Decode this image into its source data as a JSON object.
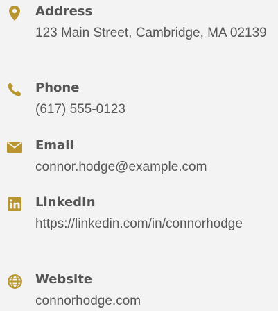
{
  "accent_color": "#b8952f",
  "contacts": [
    {
      "icon": "map-marker-icon",
      "label": "Address",
      "value": "123 Main Street, Cambridge, MA 02139"
    },
    {
      "icon": "phone-icon",
      "label": "Phone",
      "value": "(617) 555-0123"
    },
    {
      "icon": "envelope-icon",
      "label": "Email",
      "value": "connor.hodge@example.com"
    },
    {
      "icon": "linkedin-icon",
      "label": "LinkedIn",
      "value": "https://linkedin.com/in/connorhodge"
    },
    {
      "icon": "globe-icon",
      "label": "Website",
      "value": "connorhodge.com"
    }
  ]
}
